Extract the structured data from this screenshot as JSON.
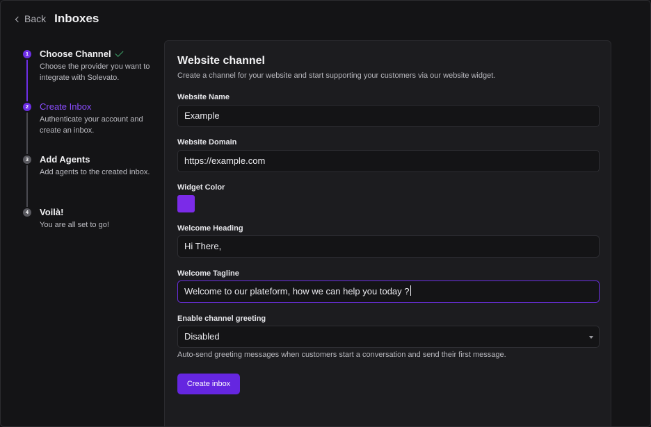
{
  "header": {
    "back_label": "Back",
    "title": "Inboxes"
  },
  "steps": [
    {
      "number": "1",
      "title": "Choose Channel",
      "description": "Choose the provider you want to integrate with Solevato."
    },
    {
      "number": "2",
      "title": "Create Inbox",
      "description": "Authenticate your account and create an inbox."
    },
    {
      "number": "3",
      "title": "Add Agents",
      "description": "Add agents to the created inbox."
    },
    {
      "number": "4",
      "title": "Voilà!",
      "description": "You are all set to go!"
    }
  ],
  "form": {
    "title": "Website channel",
    "subtitle": "Create a channel for your website and start supporting your customers via our website widget.",
    "website_name": {
      "label": "Website Name",
      "value": "Example"
    },
    "website_domain": {
      "label": "Website Domain",
      "value": "https://example.com"
    },
    "widget_color": {
      "label": "Widget Color",
      "value": "#7b2be8"
    },
    "welcome_heading": {
      "label": "Welcome Heading",
      "value": "Hi There,"
    },
    "welcome_tagline": {
      "label": "Welcome Tagline",
      "value": "Welcome to our plateform, how we can help you today ?"
    },
    "channel_greeting": {
      "label": "Enable channel greeting",
      "value": "Disabled",
      "help": "Auto-send greeting messages when customers start a conversation and send their first message."
    },
    "submit_label": "Create inbox"
  },
  "colors": {
    "accent": "#6d2ee6",
    "success": "#3fa66a"
  },
  "icons": {
    "back": "chevron-left-icon",
    "step_done": "check-icon",
    "select": "caret-down-icon"
  }
}
